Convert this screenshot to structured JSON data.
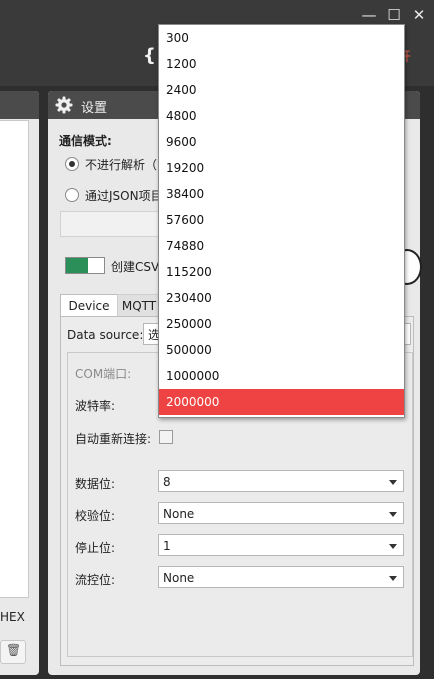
{
  "window": {
    "minimize_glyph": "—",
    "maximize_glyph": "☐",
    "close_glyph": "✕",
    "toolbar_icon_glyph": "{}",
    "open_button_label": "开"
  },
  "left_panel": {
    "hex_label": "HEX",
    "clear_icon_glyph": "🗑"
  },
  "settings": {
    "title": "设置",
    "comm_mode_label": "通信模式:",
    "mode_no_parse": "不进行解析（",
    "mode_json": "通过JSON项目",
    "csv_label": "创建CSV",
    "tabs": [
      "Device",
      "MQTT"
    ],
    "data_source_label": "Data source:",
    "data_source_value": "选",
    "com_port_label": "COM端口:",
    "baud_label": "波特率:",
    "auto_reconnect_label": "自动重新连接:",
    "data_bits_label": "数据位:",
    "data_bits_value": "8",
    "parity_label": "校验位:",
    "parity_value": "None",
    "stop_bits_label": "停止位:",
    "stop_bits_value": "1",
    "flow_label": "流控位:",
    "flow_value": "None"
  },
  "baud_dropdown": {
    "options": [
      "300",
      "1200",
      "2400",
      "4800",
      "9600",
      "19200",
      "38400",
      "57600",
      "74880",
      "115200",
      "230400",
      "250000",
      "500000",
      "1000000",
      "2000000"
    ],
    "selected": "2000000"
  },
  "colors": {
    "selection": "#ef4343",
    "toggle_on": "#2b8f5a",
    "open_button": "#e65b4c"
  }
}
